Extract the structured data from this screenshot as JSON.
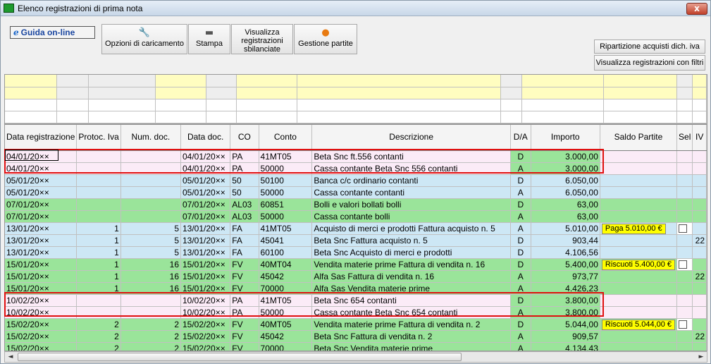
{
  "window": {
    "title": "Elenco registrazioni di prima nota",
    "close_label": "x"
  },
  "toolbar": {
    "guida_label": "Guida on-line",
    "opzioni_label": "Opzioni di caricamento",
    "stampa_label": "Stampa",
    "visualizza_label": "Visualizza registrazioni sbilanciate",
    "gestione_label": "Gestione partite",
    "ripartizione_label": "Ripartizione acquisti dich. iva",
    "visualizza_filtri_label": "Visualizza registrazioni con filtri"
  },
  "columns": [
    "Data registrazione",
    "Protoc. Iva",
    "Num. doc.",
    "Data doc.",
    "CO",
    "Conto",
    "Descrizione",
    "D/A",
    "Importo",
    "Saldo Partite",
    "Sel",
    "IV"
  ],
  "rows": [
    {
      "data": "04/01/20××",
      "prot": "",
      "num": "",
      "datadoc": "04/01/20××",
      "co": "PA",
      "conto": "41MT05",
      "desc": "Beta Snc ft.556 contanti",
      "da": "D",
      "imp": "3.000,00",
      "saldo": "",
      "sel": false,
      "iv": ""
    },
    {
      "data": "04/01/20××",
      "prot": "",
      "num": "",
      "datadoc": "04/01/20××",
      "co": "PA",
      "conto": "50000",
      "desc": "Cassa contante Beta Snc 556 contanti",
      "da": "A",
      "imp": "3.000,00",
      "saldo": "",
      "sel": false,
      "iv": ""
    },
    {
      "data": "05/01/20××",
      "prot": "",
      "num": "",
      "datadoc": "05/01/20××",
      "co": "50",
      "conto": "50100",
      "desc": "Banca c/c ordinario contanti",
      "da": "D",
      "imp": "6.050,00",
      "saldo": "",
      "sel": false,
      "iv": ""
    },
    {
      "data": "05/01/20××",
      "prot": "",
      "num": "",
      "datadoc": "05/01/20××",
      "co": "50",
      "conto": "50000",
      "desc": "Cassa contante contanti",
      "da": "A",
      "imp": "6.050,00",
      "saldo": "",
      "sel": false,
      "iv": ""
    },
    {
      "data": "07/01/20××",
      "prot": "",
      "num": "",
      "datadoc": "07/01/20××",
      "co": "AL03",
      "conto": "60851",
      "desc": "Bolli e valori bollati bolli",
      "da": "D",
      "imp": "63,00",
      "saldo": "",
      "sel": false,
      "iv": ""
    },
    {
      "data": "07/01/20××",
      "prot": "",
      "num": "",
      "datadoc": "07/01/20××",
      "co": "AL03",
      "conto": "50000",
      "desc": "Cassa contante bolli",
      "da": "A",
      "imp": "63,00",
      "saldo": "",
      "sel": false,
      "iv": ""
    },
    {
      "data": "13/01/20××",
      "prot": "1",
      "num": "5",
      "datadoc": "13/01/20××",
      "co": "FA",
      "conto": "41MT05",
      "desc": "Acquisto di merci e prodotti Fattura acquisto n. 5",
      "da": "A",
      "imp": "5.010,00",
      "saldo": "Paga 5.010,00 €",
      "sel": true,
      "iv": ""
    },
    {
      "data": "13/01/20××",
      "prot": "1",
      "num": "5",
      "datadoc": "13/01/20××",
      "co": "FA",
      "conto": "45041",
      "desc": "Beta Snc Fattura acquisto n. 5",
      "da": "D",
      "imp": "903,44",
      "saldo": "",
      "sel": false,
      "iv": "22"
    },
    {
      "data": "13/01/20××",
      "prot": "1",
      "num": "5",
      "datadoc": "13/01/20××",
      "co": "FA",
      "conto": "60100",
      "desc": "Beta Snc Acquisto di merci e prodotti",
      "da": "D",
      "imp": "4.106,56",
      "saldo": "",
      "sel": false,
      "iv": ""
    },
    {
      "data": "15/01/20××",
      "prot": "1",
      "num": "16",
      "datadoc": "15/01/20××",
      "co": "FV",
      "conto": "40MT04",
      "desc": "Vendita materie prime Fattura di vendita n. 16",
      "da": "D",
      "imp": "5.400,00",
      "saldo": "Riscuoti 5.400,00 €",
      "sel": true,
      "iv": ""
    },
    {
      "data": "15/01/20××",
      "prot": "1",
      "num": "16",
      "datadoc": "15/01/20××",
      "co": "FV",
      "conto": "45042",
      "desc": "Alfa Sas Fattura di vendita n. 16",
      "da": "A",
      "imp": "973,77",
      "saldo": "",
      "sel": false,
      "iv": "22"
    },
    {
      "data": "15/01/20××",
      "prot": "1",
      "num": "16",
      "datadoc": "15/01/20××",
      "co": "FV",
      "conto": "70000",
      "desc": "Alfa Sas Vendita materie prime",
      "da": "A",
      "imp": "4.426,23",
      "saldo": "",
      "sel": false,
      "iv": ""
    },
    {
      "data": "10/02/20××",
      "prot": "",
      "num": "",
      "datadoc": "10/02/20××",
      "co": "PA",
      "conto": "41MT05",
      "desc": "Beta Snc 654 contanti",
      "da": "D",
      "imp": "3.800,00",
      "saldo": "",
      "sel": false,
      "iv": ""
    },
    {
      "data": "10/02/20××",
      "prot": "",
      "num": "",
      "datadoc": "10/02/20××",
      "co": "PA",
      "conto": "50000",
      "desc": "Cassa contante Beta Snc 654 contanti",
      "da": "A",
      "imp": "3.800,00",
      "saldo": "",
      "sel": false,
      "iv": ""
    },
    {
      "data": "15/02/20××",
      "prot": "2",
      "num": "2",
      "datadoc": "15/02/20××",
      "co": "FV",
      "conto": "40MT05",
      "desc": "Vendita materie prime Fattura di vendita n. 2",
      "da": "D",
      "imp": "5.044,00",
      "saldo": "Riscuoti 5.044,00 €",
      "sel": true,
      "iv": ""
    },
    {
      "data": "15/02/20××",
      "prot": "2",
      "num": "2",
      "datadoc": "15/02/20××",
      "co": "FV",
      "conto": "45042",
      "desc": "Beta Snc Fattura di vendita n. 2",
      "da": "A",
      "imp": "909,57",
      "saldo": "",
      "sel": false,
      "iv": "22"
    },
    {
      "data": "15/02/20××",
      "prot": "2",
      "num": "2",
      "datadoc": "15/02/20××",
      "co": "FV",
      "conto": "70000",
      "desc": "Beta Snc Vendita materie prime",
      "da": "A",
      "imp": "4.134,43",
      "saldo": "",
      "sel": false,
      "iv": ""
    }
  ],
  "row_styles": [
    "p",
    "p",
    "b",
    "b",
    "g",
    "g",
    "b",
    "b",
    "b",
    "g",
    "g",
    "g",
    "p",
    "p",
    "g",
    "g",
    "g"
  ]
}
